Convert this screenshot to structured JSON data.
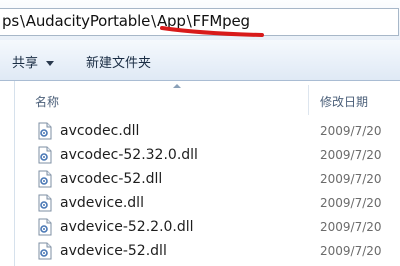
{
  "address": {
    "path_parts": [
      "ps",
      "AudacityPortable",
      "App",
      "FFMpeg"
    ],
    "separator": "\\"
  },
  "toolbar": {
    "share_label": "共享",
    "new_folder_label": "新建文件夹"
  },
  "columns": {
    "name": "名称",
    "modified": "修改日期"
  },
  "files": [
    {
      "name": "avcodec.dll",
      "date": "2009/7/20"
    },
    {
      "name": "avcodec-52.32.0.dll",
      "date": "2009/7/20"
    },
    {
      "name": "avcodec-52.dll",
      "date": "2009/7/20"
    },
    {
      "name": "avdevice.dll",
      "date": "2009/7/20"
    },
    {
      "name": "avdevice-52.2.0.dll",
      "date": "2009/7/20"
    },
    {
      "name": "avdevice-52.dll",
      "date": "2009/7/20"
    }
  ],
  "icons": {
    "file": "dll-file-icon",
    "share_dropdown": "chevron-down-icon",
    "sort": "sort-arrow-icon"
  },
  "colors": {
    "annotation_underline": "#d81a1a",
    "header_text": "#4c607a",
    "toolbar_bg": "#dfe9f5"
  }
}
